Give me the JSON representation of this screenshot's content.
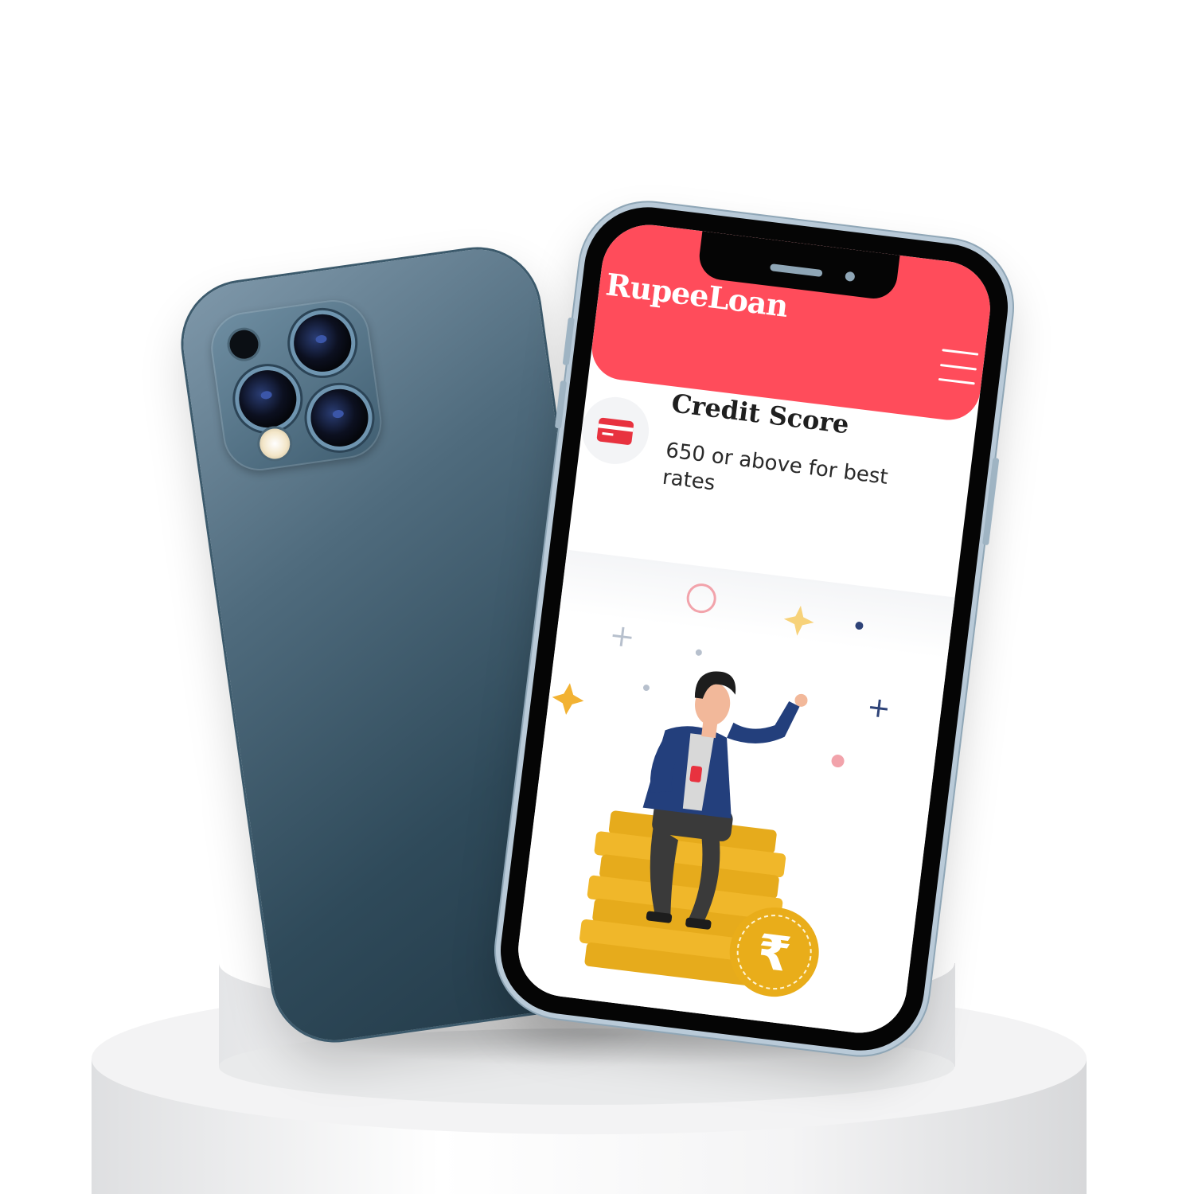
{
  "app": {
    "brand_name": "RupeeLoan",
    "menu_icon": "hamburger-menu-icon",
    "accent_color": "#ff4c5b"
  },
  "feature": {
    "icon": "credit-card-icon",
    "title": "Credit Score",
    "description": "650 or above for best rates"
  },
  "illustration": {
    "currency_symbol": "₹",
    "subject": "man-sitting-on-coin-stack"
  }
}
